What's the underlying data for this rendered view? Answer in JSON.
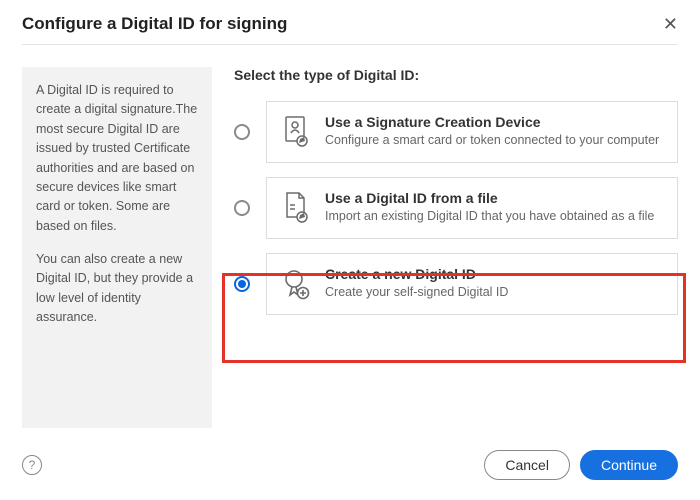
{
  "header": {
    "title": "Configure a Digital ID for signing"
  },
  "sidebar": {
    "p1": "A Digital ID is required to create a digital signature.The most secure Digital ID are issued by trusted Certificate authorities and are based on secure devices like smart card or token. Some are based on files.",
    "p2": "You can also create a new Digital ID, but they provide a low level of identity assurance."
  },
  "main": {
    "prompt": "Select the type of Digital ID:",
    "options": [
      {
        "icon": "signature-device-icon",
        "title": "Use a Signature Creation Device",
        "desc": "Configure a smart card or token connected to your computer",
        "selected": false
      },
      {
        "icon": "file-id-icon",
        "title": "Use a Digital ID from a file",
        "desc": "Import an existing Digital ID that you have obtained as a file",
        "selected": false
      },
      {
        "icon": "new-id-icon",
        "title": "Create a new Digital ID",
        "desc": "Create your self-signed Digital ID",
        "selected": true
      }
    ]
  },
  "footer": {
    "help": "?",
    "cancel": "Cancel",
    "continue": "Continue"
  }
}
